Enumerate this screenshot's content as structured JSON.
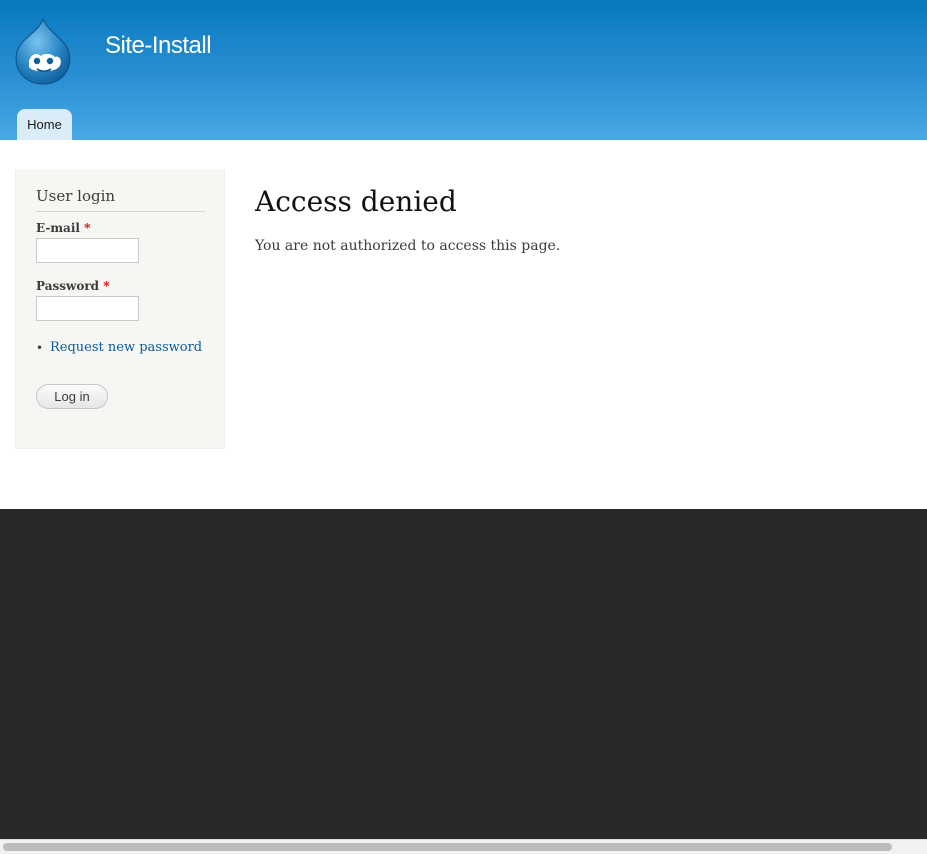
{
  "header": {
    "site_name": "Site-Install",
    "logo_icon": "drupal-drop-icon",
    "tabs": [
      {
        "label": "Home"
      }
    ]
  },
  "sidebar": {
    "block_title": "User login",
    "email_label": "E-mail",
    "password_label": "Password",
    "required_marker": "*",
    "email_value": "",
    "password_value": "",
    "bullet": "•",
    "request_password_link": "Request new password",
    "login_button": "Log in"
  },
  "main": {
    "title": "Access denied",
    "message": "You are not authorized to access this page."
  },
  "colors": {
    "header_top": "#0779bf",
    "header_bottom": "#48a9e4",
    "link": "#0a5ba0",
    "required": "#dd0000",
    "footer": "#292929",
    "sidebar_bg": "#f6f6f2"
  }
}
